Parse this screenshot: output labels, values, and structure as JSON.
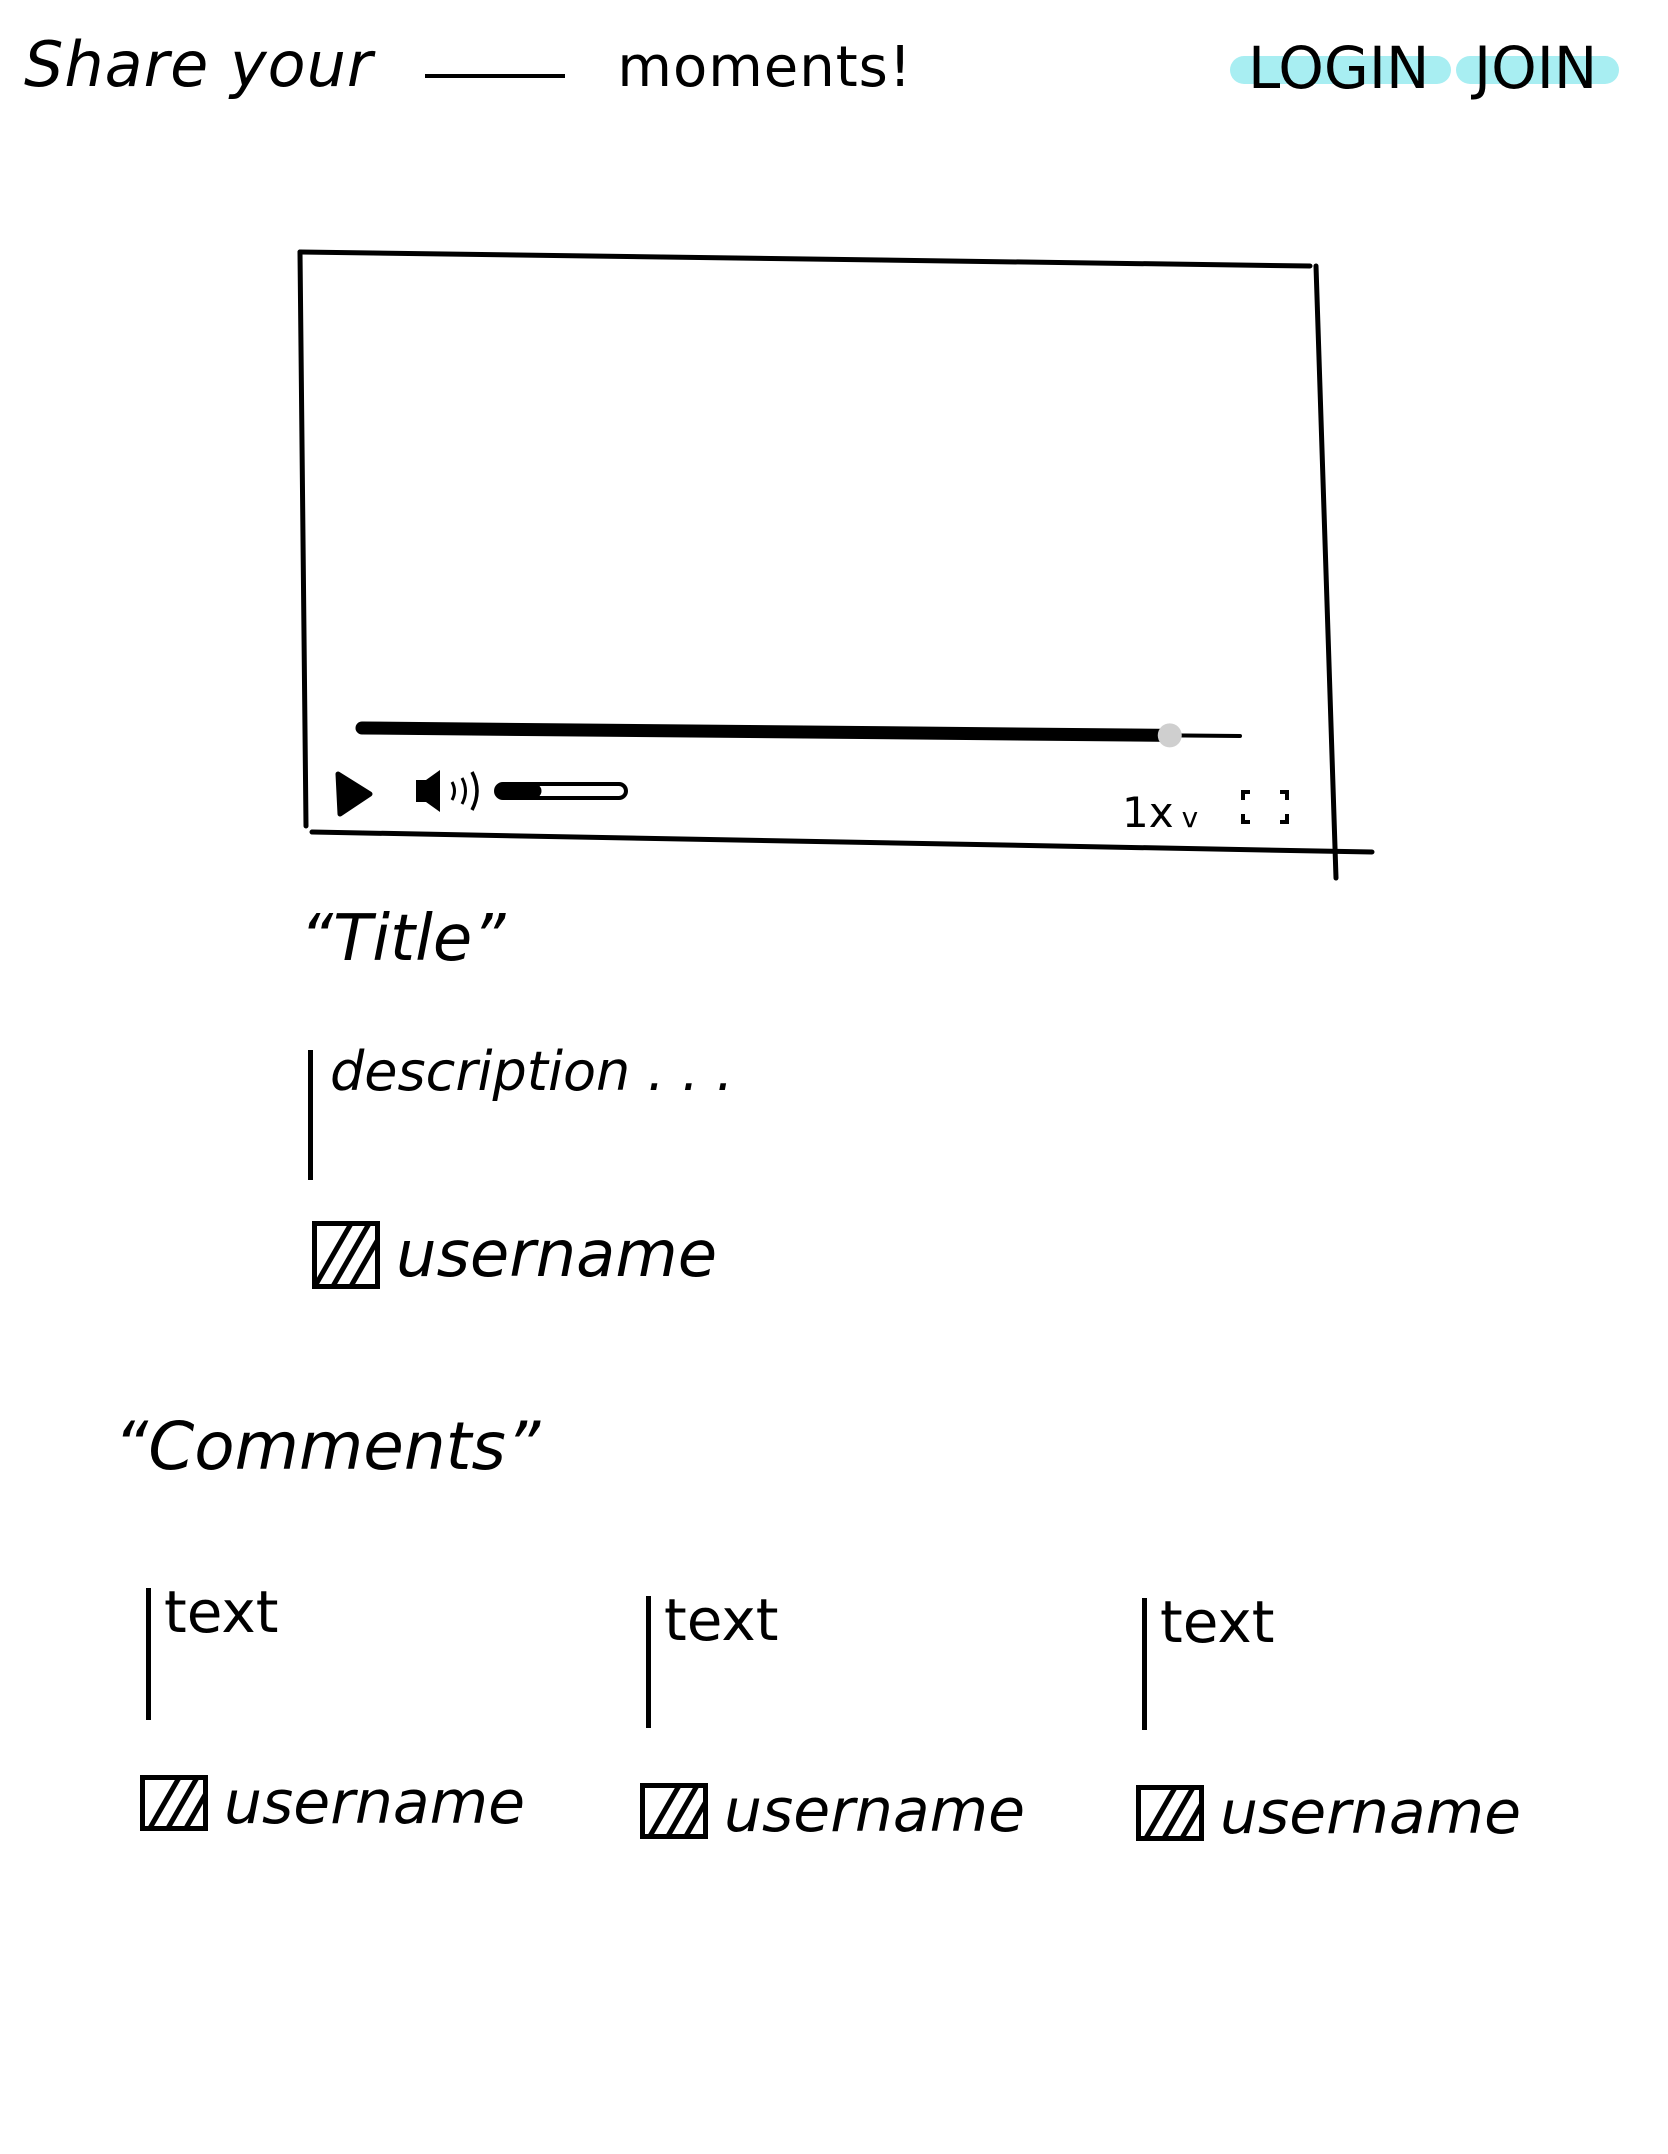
{
  "header": {
    "tagline_start": "Share your",
    "tagline_end": "moments!",
    "login_label": "LOGIN",
    "join_label": "JOIN",
    "highlight_color": "#a8eef2"
  },
  "video": {
    "progress": 0.92,
    "volume": 0.35,
    "speed_label": "1x",
    "speed_chevron": "v",
    "play_icon": "play-icon",
    "volume_icon": "speaker-icon",
    "fullscreen_icon": "fullscreen-icon"
  },
  "post": {
    "title": "“Title”",
    "description": "description . . .",
    "username": "username"
  },
  "comments": {
    "heading": "“Comments”",
    "items": [
      {
        "text": "text",
        "username": "username"
      },
      {
        "text": "text",
        "username": "username"
      },
      {
        "text": "text",
        "username": "username"
      }
    ]
  }
}
